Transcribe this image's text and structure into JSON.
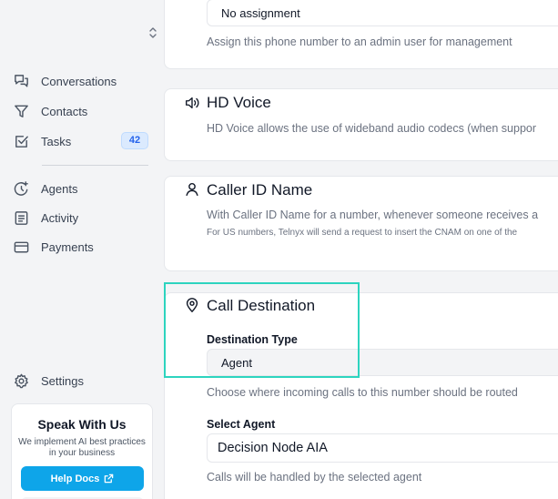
{
  "sidebar": {
    "items": [
      {
        "label": "Conversations",
        "icon": "chat-bubbles-icon"
      },
      {
        "label": "Contacts",
        "icon": "funnel-icon"
      },
      {
        "label": "Tasks",
        "icon": "checkbox-icon",
        "badge": "42"
      },
      {
        "label": "Agents",
        "icon": "agent-sparkle-icon"
      },
      {
        "label": "Activity",
        "icon": "document-list-icon"
      },
      {
        "label": "Payments",
        "icon": "credit-card-icon"
      }
    ],
    "settings_label": "Settings",
    "promo": {
      "title": "Speak With Us",
      "subtitle": "We implement AI best practices in your business",
      "button_label": "Help Docs"
    }
  },
  "assignment": {
    "value": "No assignment",
    "description": "Assign this phone number to an admin user for management"
  },
  "hd_voice": {
    "title": "HD Voice",
    "description": "HD Voice allows the use of wideband audio codecs (when suppor"
  },
  "caller_id": {
    "title": "Caller ID Name",
    "description": "With Caller ID Name for a number, whenever someone receives a",
    "note": "For US numbers, Telnyx will send a request to insert the CNAM on one of the"
  },
  "call_destination": {
    "title": "Call Destination",
    "destination_type_label": "Destination Type",
    "destination_type_value": "Agent",
    "destination_type_hint": "Choose where incoming calls to this number should be routed",
    "select_agent_label": "Select Agent",
    "select_agent_value": "Decision Node AIA",
    "select_agent_hint": "Calls will be handled by the selected agent"
  },
  "colors": {
    "accent": "#0ea5e9",
    "highlight": "#2dd4bf",
    "badge_bg": "#dbeafe",
    "badge_text": "#2563eb"
  }
}
